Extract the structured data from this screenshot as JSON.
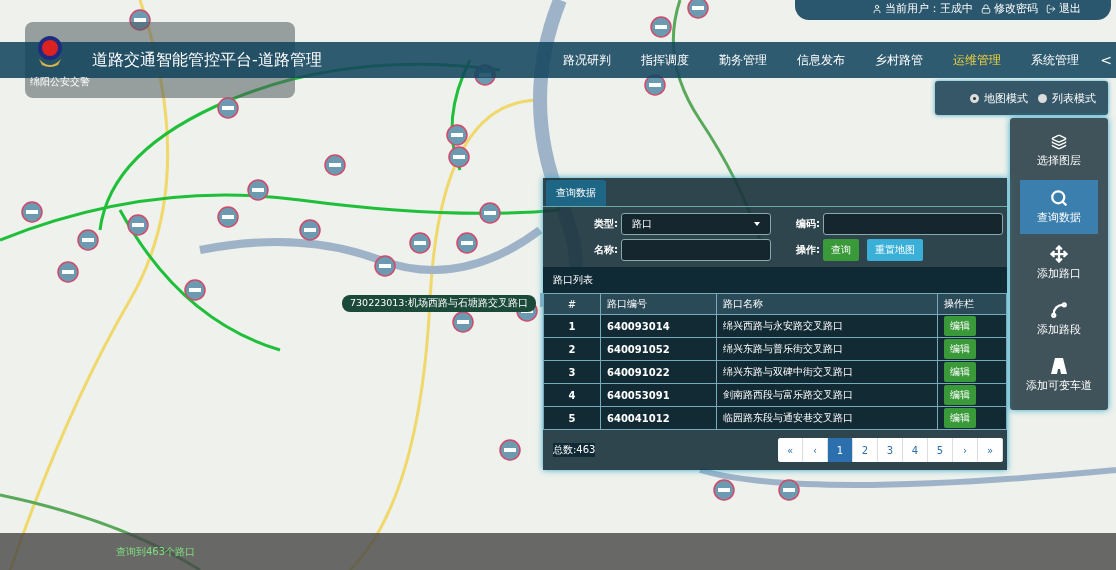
{
  "header": {
    "title": "道路交通智能管控平台-道路管理",
    "org": "绵阳公安交警",
    "nav": [
      {
        "label": "路况研判",
        "selected": false
      },
      {
        "label": "指挥调度",
        "selected": false
      },
      {
        "label": "勤务管理",
        "selected": false
      },
      {
        "label": "信息发布",
        "selected": false
      },
      {
        "label": "乡村路管",
        "selected": false
      },
      {
        "label": "运维管理",
        "selected": true
      },
      {
        "label": "系统管理",
        "selected": false
      }
    ],
    "collapse": "<"
  },
  "user_bar": {
    "user": "当前用户：王成中",
    "change_password": "修改密码",
    "logout": "退出"
  },
  "mode_toggle": [
    {
      "label": "地图模式",
      "selected": true
    },
    {
      "label": "列表模式",
      "selected": false
    }
  ],
  "toolbar": [
    {
      "label": "选择图层",
      "kind": "layers",
      "selected": false
    },
    {
      "label": "查询数据",
      "kind": "search",
      "selected": true
    },
    {
      "label": "添加路口",
      "kind": "crossing",
      "selected": false
    },
    {
      "label": "添加路段",
      "kind": "segment",
      "selected": false
    },
    {
      "label": "添加可变车道",
      "kind": "lane",
      "selected": false
    }
  ],
  "map": {
    "tooltip": "730223013:机场西路与石塘路交叉路口"
  },
  "query_panel": {
    "tab": "查询数据",
    "type_label": "类型:",
    "type_value": "路口",
    "code_label": "编码:",
    "name_label": "名称:",
    "action_label": "操作:",
    "search_button": "查询",
    "reset_button": "重置地图",
    "list_title": "路口列表",
    "table": {
      "columns": [
        "#",
        "路口编号",
        "路口名称",
        "操作栏"
      ],
      "rows": [
        {
          "index": "1",
          "code": "640093014",
          "name": "绵兴西路与永安路交叉路口",
          "action": "编辑"
        },
        {
          "index": "2",
          "code": "640091052",
          "name": "绵兴东路与普乐街交叉路口",
          "action": "编辑"
        },
        {
          "index": "3",
          "code": "640091022",
          "name": "绵兴东路与双碑中街交叉路口",
          "action": "编辑"
        },
        {
          "index": "4",
          "code": "640053091",
          "name": "剑南路西段与富乐路交叉路口",
          "action": "编辑"
        },
        {
          "index": "5",
          "code": "640041012",
          "name": "临园路东段与通安巷交叉路口",
          "action": "编辑"
        }
      ]
    },
    "total": "总数:463",
    "pagination": [
      {
        "label": "«",
        "selected": false
      },
      {
        "label": "‹",
        "selected": false
      },
      {
        "label": "1",
        "selected": true
      },
      {
        "label": "2",
        "selected": false
      },
      {
        "label": "3",
        "selected": false
      },
      {
        "label": "4",
        "selected": false
      },
      {
        "label": "5",
        "selected": false
      },
      {
        "label": "›",
        "selected": false
      },
      {
        "label": "»",
        "selected": false
      }
    ]
  },
  "status_bar": {
    "text": "查询到463个路口"
  }
}
